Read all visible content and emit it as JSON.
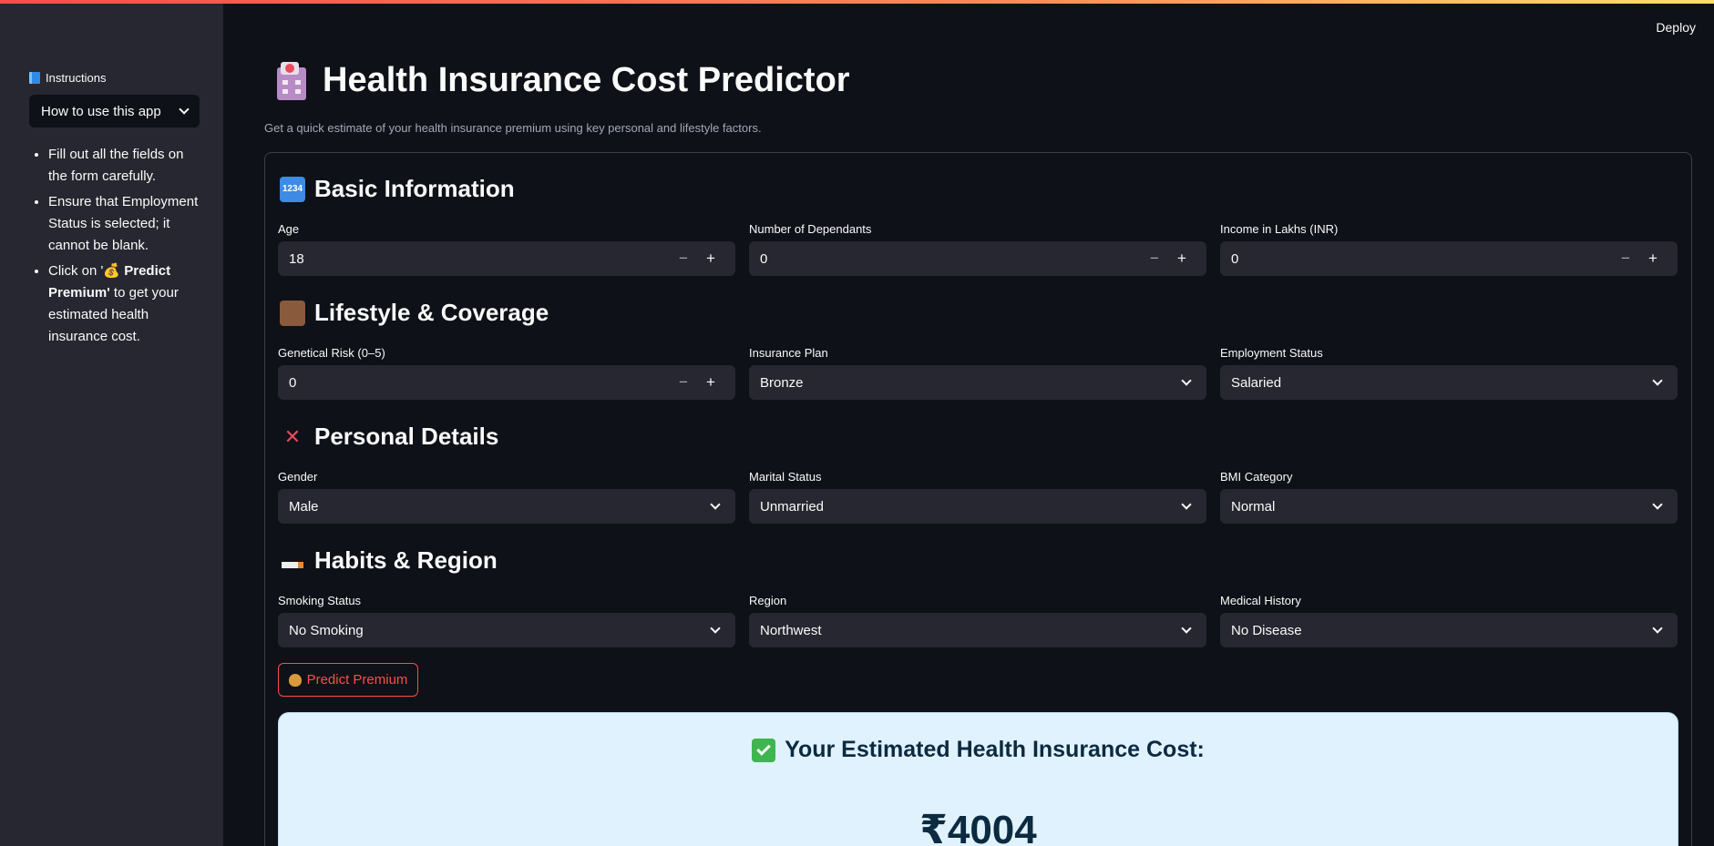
{
  "app": {
    "deploy_label": "Deploy",
    "title": "Health Insurance Cost Predictor",
    "subtitle": "Get a quick estimate of your health insurance premium using key personal and lifestyle factors."
  },
  "sidebar": {
    "instructions_label": "Instructions",
    "expander_label": "How to use this app",
    "items": [
      {
        "text": "Fill out all the fields on the form carefully."
      },
      {
        "text": "Ensure that Employment Status is selected; it cannot be blank."
      },
      {
        "pre": "Click on '",
        "bold": "💰 Predict Premium'",
        "post": " to get your estimated health insurance cost."
      }
    ]
  },
  "sections": {
    "basic": {
      "icon": "1234",
      "title": "Basic Information"
    },
    "lifestyle": {
      "icon": "briefcase-icon",
      "title": "Lifestyle & Coverage"
    },
    "personal": {
      "icon": "dna-icon",
      "title": "Personal Details"
    },
    "habits": {
      "icon": "cigarette-icon",
      "title": "Habits & Region"
    }
  },
  "fields": {
    "age": {
      "label": "Age",
      "value": "18"
    },
    "dependants": {
      "label": "Number of Dependants",
      "value": "0"
    },
    "income": {
      "label": "Income in Lakhs (INR)",
      "value": "0"
    },
    "genetical_risk": {
      "label": "Genetical Risk (0–5)",
      "value": "0"
    },
    "insurance_plan": {
      "label": "Insurance Plan",
      "value": "Bronze"
    },
    "employment_status": {
      "label": "Employment Status",
      "value": "Salaried"
    },
    "gender": {
      "label": "Gender",
      "value": "Male"
    },
    "marital_status": {
      "label": "Marital Status",
      "value": "Unmarried"
    },
    "bmi_category": {
      "label": "BMI Category",
      "value": "Normal"
    },
    "smoking_status": {
      "label": "Smoking Status",
      "value": "No Smoking"
    },
    "region": {
      "label": "Region",
      "value": "Northwest"
    },
    "medical_history": {
      "label": "Medical History",
      "value": "No Disease"
    }
  },
  "predict_button": {
    "label": "Predict Premium"
  },
  "result": {
    "title": "Your Estimated Health Insurance Cost:",
    "value": "₹4004"
  },
  "colors": {
    "accent": "#ff4b4b",
    "background": "#0e1117",
    "sidebar": "#262730",
    "result_bg": "#e0f2fe"
  }
}
